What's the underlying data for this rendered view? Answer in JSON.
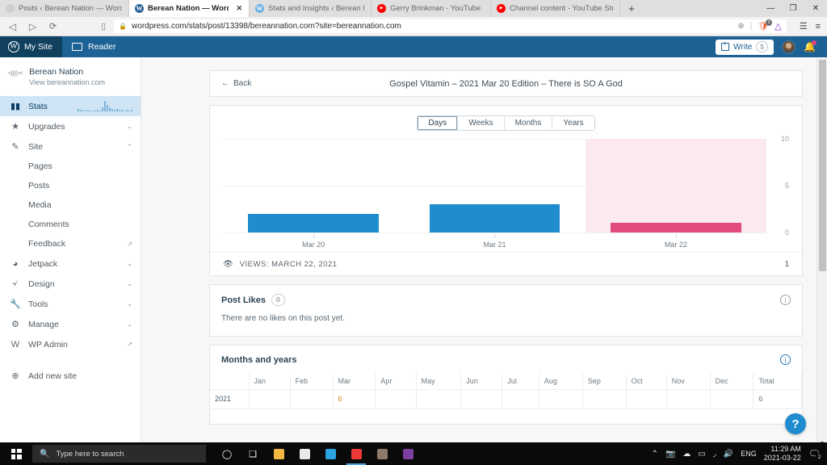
{
  "browser": {
    "tabs": [
      {
        "title": "Posts ‹ Berean Nation — WordPress",
        "favicon": "gray-favicon",
        "active": false,
        "closable": false
      },
      {
        "title": "Berean Nation — WordPress.com",
        "favicon": "wordpress-favicon",
        "active": true,
        "closable": true
      },
      {
        "title": "Stats and Insights ‹ Berean Nation —",
        "favicon": "wordpress-favicon",
        "active": false,
        "closable": false
      },
      {
        "title": "Gerry Brinkman - YouTube",
        "favicon": "youtube-favicon",
        "active": false,
        "closable": false
      },
      {
        "title": "Channel content - YouTube Studio",
        "favicon": "youtube-favicon",
        "active": false,
        "closable": false
      }
    ],
    "new_tab_label": "+",
    "window_controls": {
      "minimize": "—",
      "maximize": "❐",
      "close": "✕"
    },
    "nav": {
      "back": "◁",
      "forward": "▷",
      "reload": "⟳",
      "bookmark": "▯"
    },
    "url": "wordpress.com/stats/post/13398/bereannation.com?site=bereannation.com",
    "url_icons": {
      "lock": "🔒",
      "zoom": "⊕",
      "shield_badge": "0",
      "extension": "△"
    },
    "toolbar_right": {
      "panel": "☰",
      "menu": "≡"
    }
  },
  "masterbar": {
    "my_site": "My Site",
    "reader": "Reader",
    "write_label": "Write",
    "write_count": "5",
    "notification_icon": "bell-icon"
  },
  "sidebar": {
    "site_name": "Berean Nation",
    "site_url": "View bereannation.com",
    "items": [
      {
        "label": "Stats",
        "icon": "bar-chart-icon",
        "active": true,
        "sparkline": true
      },
      {
        "label": "Upgrades",
        "icon": "star-icon",
        "chevron": "⌄"
      },
      {
        "label": "Site",
        "icon": "pencil-icon",
        "chevron": "⌃"
      }
    ],
    "site_children": [
      {
        "label": "Pages"
      },
      {
        "label": "Posts"
      },
      {
        "label": "Media"
      },
      {
        "label": "Comments"
      },
      {
        "label": "Feedback",
        "external": true
      }
    ],
    "items_lower": [
      {
        "label": "Jetpack",
        "icon": "jetpack-icon",
        "chevron": "⌄"
      },
      {
        "label": "Design",
        "icon": "design-icon",
        "chevron": "⌄"
      },
      {
        "label": "Tools",
        "icon": "wrench-icon",
        "chevron": "⌄"
      },
      {
        "label": "Manage",
        "icon": "gear-icon",
        "chevron": "⌄"
      },
      {
        "label": "WP Admin",
        "icon": "wordpress-icon",
        "external": true
      }
    ],
    "add_new_site": "Add new site",
    "sparkline_values": [
      2,
      1,
      1,
      0,
      1,
      0,
      0,
      0,
      1,
      0,
      3,
      8,
      5,
      3,
      2,
      1,
      2,
      1,
      1,
      0,
      1,
      0,
      1
    ]
  },
  "main": {
    "back_label": "Back",
    "post_title": "Gospel Vitamin – 2021 Mar 20 Edition – There is SO A God",
    "period_tabs": [
      {
        "label": "Days",
        "selected": true
      },
      {
        "label": "Weeks",
        "selected": false
      },
      {
        "label": "Months",
        "selected": false
      },
      {
        "label": "Years",
        "selected": false
      }
    ],
    "views_row": {
      "label": "VIEWS: MARCH 22, 2021",
      "value": "1",
      "icon": "eye-icon"
    },
    "post_likes": {
      "title": "Post Likes",
      "count": "0",
      "empty_message": "There are no likes on this post yet."
    },
    "months_and_years": {
      "title": "Months and years",
      "columns": [
        "",
        "Jan",
        "Feb",
        "Mar",
        "Apr",
        "May",
        "Jun",
        "Jul",
        "Aug",
        "Sep",
        "Oct",
        "Nov",
        "Dec",
        "Total"
      ],
      "rows": [
        {
          "year": "2021",
          "values": [
            "",
            "",
            "6",
            "",
            "",
            "",
            "",
            "",
            "",
            "",
            "",
            "",
            "6"
          ]
        }
      ]
    },
    "help_label": "?"
  },
  "chart_data": {
    "type": "bar",
    "title": "",
    "categories": [
      "Mar 20",
      "Mar 21",
      "Mar 22"
    ],
    "values": [
      2,
      3,
      1
    ],
    "colors": [
      "#1e8cce",
      "#1e8cce",
      "#e34a7f"
    ],
    "highlighted_index": 2,
    "highlight_color": "#fce8ef",
    "ylim": [
      0,
      10
    ],
    "yticks": [
      "0",
      "5",
      "10"
    ],
    "xlabel": "",
    "ylabel": "",
    "grid": true,
    "legend": "none"
  },
  "taskbar": {
    "search_placeholder": "Type here to search",
    "icons": [
      {
        "name": "cortana-icon",
        "glyph": "◯",
        "color": "#ffffff"
      },
      {
        "name": "task-view-icon",
        "glyph": "❑",
        "color": "#ffffff"
      },
      {
        "name": "file-explorer-icon",
        "glyph": "▰",
        "color": "#f5b642"
      },
      {
        "name": "microsoft-store-icon",
        "glyph": "▣",
        "color": "#e8e8e8"
      },
      {
        "name": "mail-icon",
        "glyph": "✉",
        "color": "#2aa3e0"
      },
      {
        "name": "vivaldi-icon",
        "glyph": "◆",
        "color": "#ef3939"
      },
      {
        "name": "dictionary-icon",
        "glyph": "▤",
        "color": "#8d7a6a"
      },
      {
        "name": "onenote-icon",
        "glyph": "N",
        "color": "#7b3f9d"
      }
    ],
    "tray": {
      "chevron": "⌃",
      "items": [
        "camera-icon",
        "onedrive-icon",
        "battery-icon",
        "wifi-icon",
        "volume-icon"
      ],
      "language": "ENG",
      "time": "11:29 AM",
      "date": "2021-03-22",
      "notification_count": "2"
    }
  }
}
